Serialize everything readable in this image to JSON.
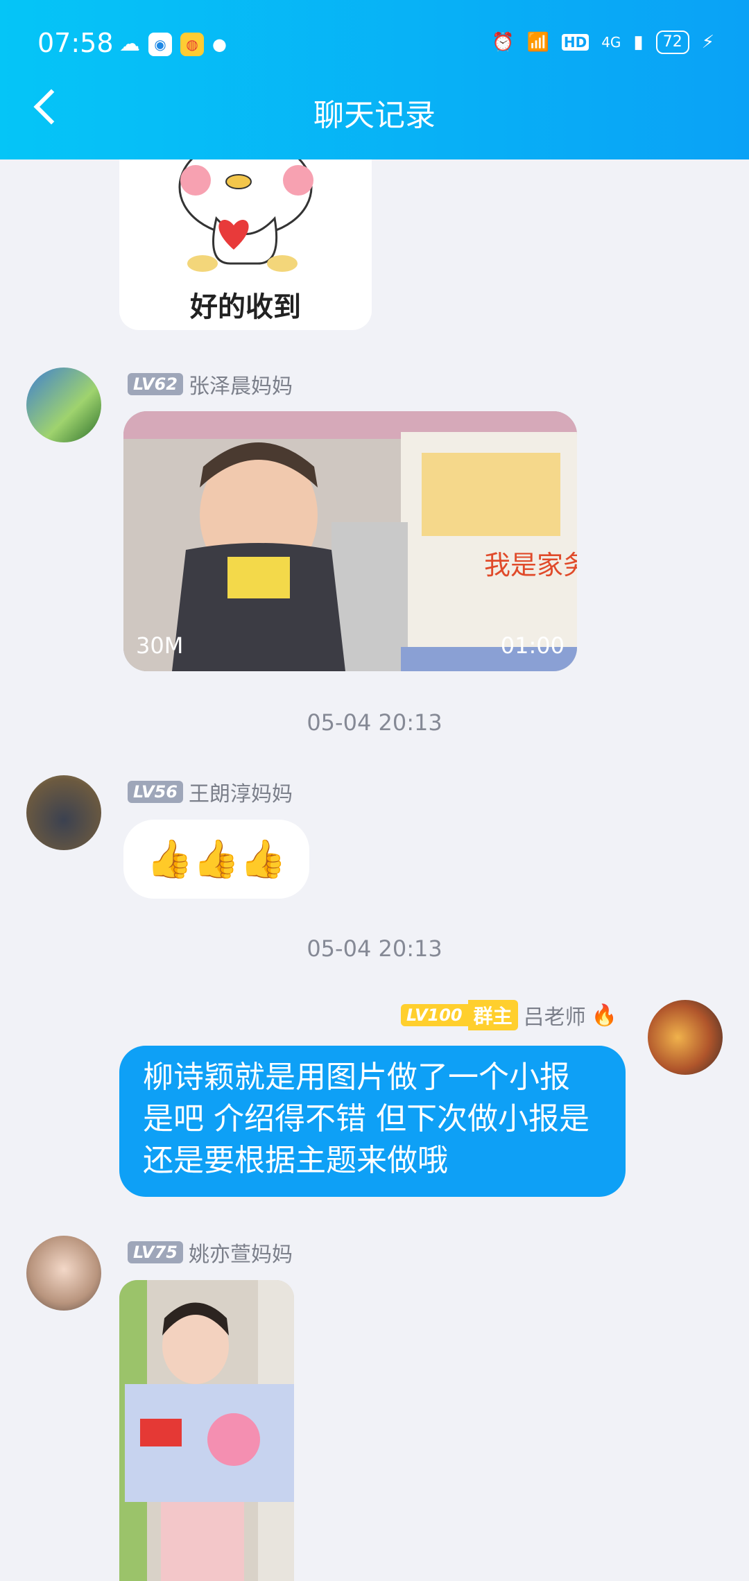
{
  "status_bar": {
    "time": "07:58",
    "network_badges": [
      "HD",
      "4G"
    ],
    "battery": "72"
  },
  "header": {
    "title": "聊天记录"
  },
  "messages": [
    {
      "type": "sticker",
      "text": "好的收到"
    },
    {
      "type": "video",
      "level": "LV62",
      "sender": "张泽晨妈妈",
      "size": "30M",
      "duration": "01:00"
    },
    {
      "type": "timestamp",
      "text": "05-04 20:13"
    },
    {
      "type": "emoji",
      "level": "LV56",
      "sender": "王朗淳妈妈",
      "content": "👍👍👍"
    },
    {
      "type": "timestamp",
      "text": "05-04 20:13"
    },
    {
      "type": "text",
      "level": "LV100",
      "badge": "群主",
      "sender": "吕老师",
      "sender_emoji": "🔥",
      "lines": [
        "柳诗颖就是用图片做了一个小报",
        "是吧 介绍得不错 但下次做小报是",
        "还是要根据主题来做哦"
      ]
    },
    {
      "type": "image",
      "level": "LV75",
      "sender": "姚亦萱妈妈"
    }
  ],
  "colors": {
    "header_start": "#05c5f7",
    "header_end": "#0aa2f6",
    "bubble_self": "#0ea0f6",
    "background": "#f1f2f7"
  }
}
